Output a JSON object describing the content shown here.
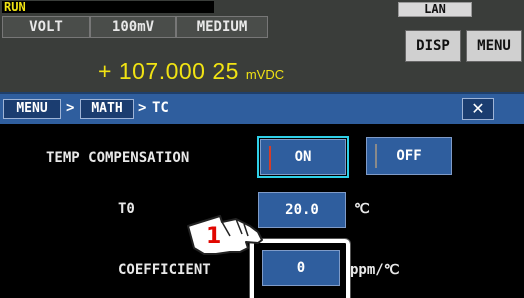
{
  "status": {
    "run": "RUN",
    "lan": "LAN",
    "function": "VOLT",
    "range": "100mV",
    "speed": "MEDIUM",
    "disp_label": "DISP",
    "menu_label": "MENU",
    "reading": "+ 107.000 25",
    "reading_unit": "mVDC"
  },
  "breadcrumb": {
    "items": [
      "MENU",
      "MATH"
    ],
    "current": "TC",
    "separator": ">",
    "close": "✕"
  },
  "settings": {
    "temp_comp_label": "TEMP COMPENSATION",
    "on_label": "ON",
    "off_label": "OFF",
    "t0_label": "T0",
    "t0_value": "20.0",
    "t0_unit": "℃",
    "coeff_label": "COEFFICIENT",
    "coeff_value": "0",
    "coeff_unit": "ppm/℃"
  },
  "callout": {
    "number": "1"
  },
  "colors": {
    "reading": "#f1e313",
    "crumbbar": "#2f5e9e",
    "field": "#2f5e9e",
    "on_indicator": "#d53d2a",
    "on_outline": "#2fd0e8"
  }
}
